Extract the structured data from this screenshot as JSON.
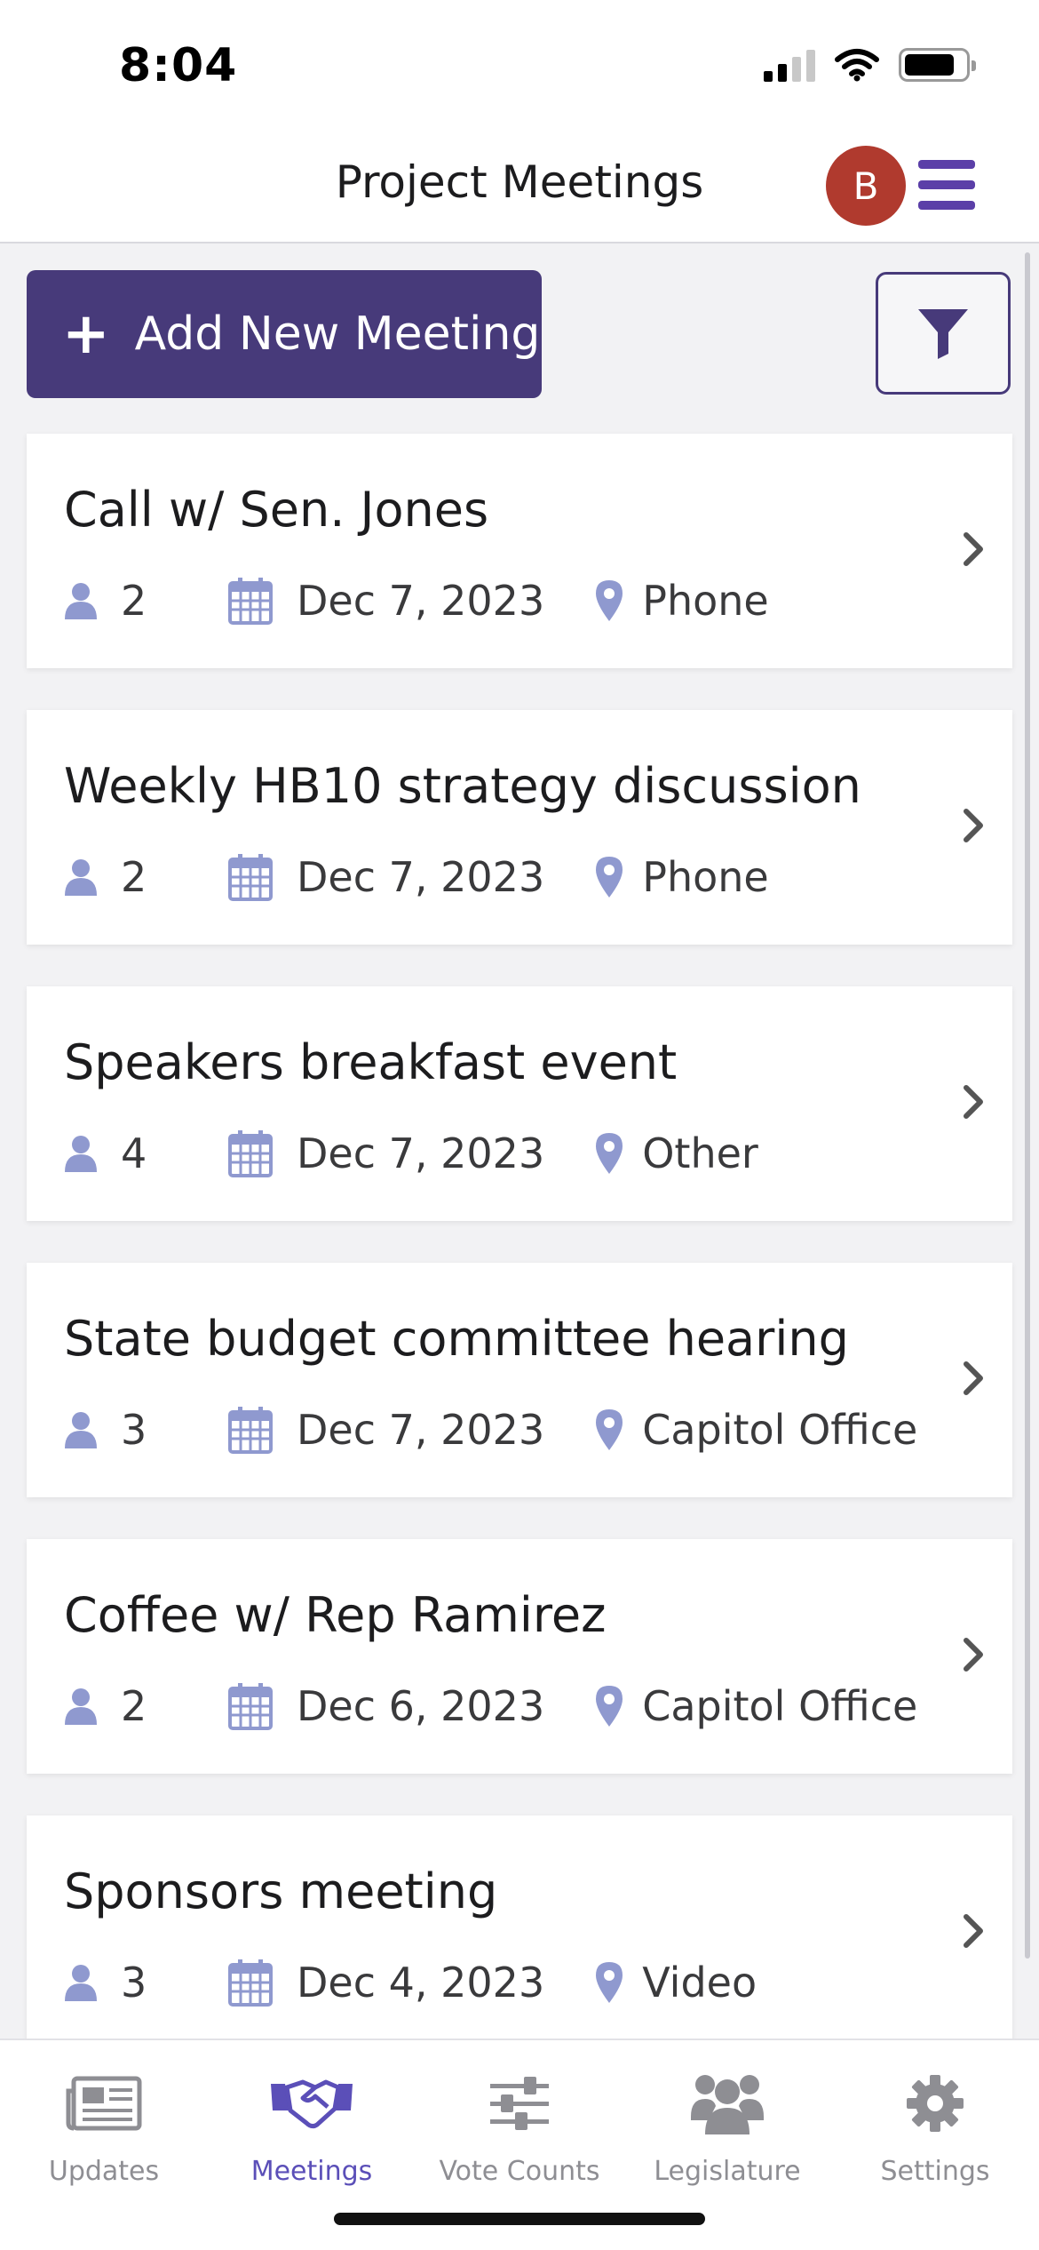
{
  "status_bar": {
    "time": "8:04"
  },
  "header": {
    "title": "Project Meetings",
    "avatar_initial": "B"
  },
  "toolbar": {
    "add_label": "Add New Meeting"
  },
  "meetings": [
    {
      "title": "Call w/ Sen. Jones",
      "attendees": "2",
      "date": "Dec 7, 2023",
      "location": "Phone"
    },
    {
      "title": "Weekly HB10 strategy discussion",
      "attendees": "2",
      "date": "Dec 7, 2023",
      "location": "Phone"
    },
    {
      "title": "Speakers breakfast event",
      "attendees": "4",
      "date": "Dec 7, 2023",
      "location": "Other"
    },
    {
      "title": "State budget committee hearing",
      "attendees": "3",
      "date": "Dec 7, 2023",
      "location": "Capitol Office"
    },
    {
      "title": "Coffee w/ Rep Ramirez",
      "attendees": "2",
      "date": "Dec 6, 2023",
      "location": "Capitol Office"
    },
    {
      "title": "Sponsors meeting",
      "attendees": "3",
      "date": "Dec 4, 2023",
      "location": "Video"
    }
  ],
  "tabs": [
    {
      "label": "Updates",
      "icon": "newspaper-icon",
      "active": false
    },
    {
      "label": "Meetings",
      "icon": "handshake-icon",
      "active": true
    },
    {
      "label": "Vote Counts",
      "icon": "sliders-icon",
      "active": false
    },
    {
      "label": "Legislature",
      "icon": "users-icon",
      "active": false
    },
    {
      "label": "Settings",
      "icon": "gear-icon",
      "active": false
    }
  ],
  "colors": {
    "primary": "#473a7a",
    "accent": "#5b4fb8",
    "icon": "#8f99cf",
    "avatar": "#b03a2e",
    "inactive_tab": "#8e8e93"
  }
}
